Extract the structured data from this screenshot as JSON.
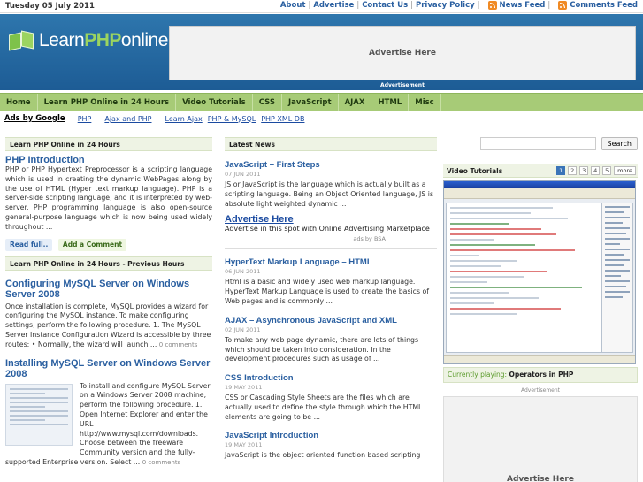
{
  "topbar": {
    "date": "Tuesday 05 July 2011",
    "links": [
      "About",
      "Advertise",
      "Contact Us",
      "Privacy Policy"
    ],
    "news_feed": "News Feed",
    "comments_feed": "Comments Feed"
  },
  "header": {
    "logo_learn": "Learn",
    "logo_php": "PHP",
    "logo_online": "online",
    "ad_text": "Advertise Here",
    "ad_label": "Advertisement"
  },
  "nav": [
    "Home",
    "Learn PHP Online in 24 Hours",
    "Video Tutorials",
    "CSS",
    "JavaScript",
    "AJAX",
    "HTML",
    "Misc"
  ],
  "subnav": {
    "ads": "Ads by Google",
    "links": [
      "PHP",
      "Ajax and PHP",
      "Learn Ajax",
      "PHP & MySQL",
      "PHP XML DB"
    ]
  },
  "left": {
    "section1": "Learn PHP Online in 24 Hours",
    "featured": {
      "title": "PHP Introduction",
      "text": "PHP or PHP Hypertext Preprocessor is a scripting language which is used in creating the dynamic WebPages along by the use of HTML (Hyper text markup language). PHP is a server-side scripting language, and it is interpreted by web-server. PHP programming language is also open-source general-purpose language which is now being used widely throughout ...",
      "read_full": "Read full..",
      "add_comment": "Add a Comment"
    },
    "section2": "Learn PHP Online in 24 Hours - Previous Hours",
    "post1": {
      "title": "Configuring MySQL Server on Windows Server 2008",
      "text": "Once installation is complete, MySQL provides a wizard for configuring the MySQL instance. To make configuring settings, perform the following procedure. 1. The MySQL Server Instance Configuration Wizard is accessible by three routes: • Normally, the wizard will launch ...",
      "comments": "0 comments"
    },
    "post2": {
      "title": "Installing MySQL Server on Windows Server 2008",
      "text": "To install and configure MySQL Server on a Windows Server 2008 machine, perform the following procedure. 1. Open Internet Explorer and enter the URL http://www.mysql.com/downloads. Choose between the freeware Community version and the fully-supported Enterprise version. Select ...",
      "comments": "0 comments"
    }
  },
  "news": {
    "head": "Latest News",
    "items": [
      {
        "title": "JavaScript – First Steps",
        "date": "07 JUN 2011",
        "text": "JS or JavaScript is the language which is actually built as a scripting language. Being an Object Oriented language, JS is absolute light weighted dynamic ..."
      },
      {
        "title": "HyperText Markup Language – HTML",
        "date": "06 JUN 2011",
        "text": "Html is a basic and widely used web markup language. HyperText Markup Language is used to create the basics of Web pages and is commonly ..."
      },
      {
        "title": "AJAX – Asynchronous JavaScript and XML",
        "date": "02 JUN 2011",
        "text": "To make any web page dynamic, there are lots of things which should be taken into consideration. In the development procedures such as usage of ..."
      },
      {
        "title": "CSS Introduction",
        "date": "19 MAY 2011",
        "text": "CSS or Cascading Style Sheets are the files which are actually used to define the style through which the HTML elements are going to be ..."
      },
      {
        "title": "JavaScript Introduction",
        "date": "19 MAY 2011",
        "text": "JavaScript is the object oriented function based scripting"
      }
    ],
    "ad": {
      "title": "Advertise Here",
      "text": "Advertise in this spot with Online Advertising Marketplace",
      "by": "ads by BSA"
    }
  },
  "sidebar": {
    "search_placeholder": "",
    "search_button": "Search",
    "video_head": "Video Tutorials",
    "pages": [
      "1",
      "2",
      "3",
      "4",
      "5"
    ],
    "more": "more",
    "playing_label": "Currently playing:",
    "playing_value": "Operators in PHP",
    "ad_label": "Advertisement",
    "ad_text": "Advertise Here"
  }
}
